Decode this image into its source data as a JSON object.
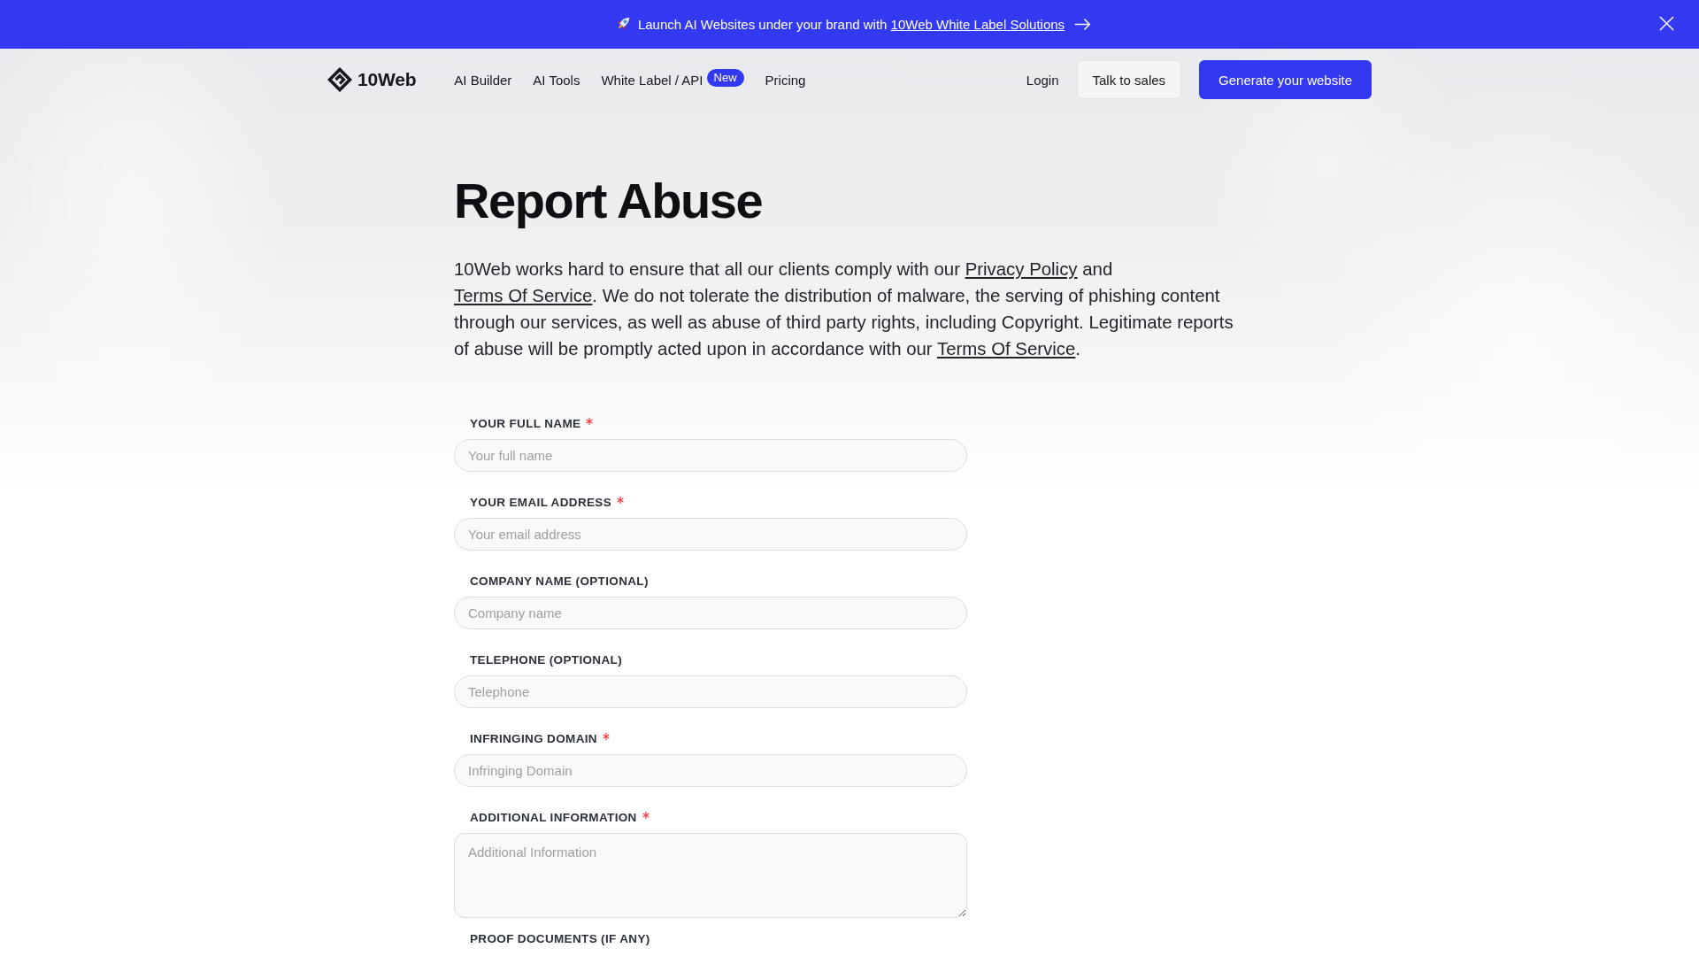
{
  "banner": {
    "message": "Launch AI Websites under your brand with",
    "link": "10Web White Label Solutions"
  },
  "nav": {
    "logo": "10Web",
    "links": [
      {
        "label": "AI Builder"
      },
      {
        "label": "AI Tools"
      },
      {
        "label": "White Label / API",
        "badge": "New"
      },
      {
        "label": "Pricing"
      }
    ],
    "login": "Login",
    "secondary_button": "Talk to sales",
    "primary_button": "Generate your website"
  },
  "page": {
    "title": "Report Abuse",
    "intro": [
      {
        "kind": "text",
        "text": "10Web works hard to ensure that all our clients comply with our "
      },
      {
        "kind": "link",
        "text": "Privacy Policy"
      },
      {
        "kind": "text",
        "text": " and "
      },
      {
        "kind": "link",
        "text": "Terms Of Service"
      },
      {
        "kind": "text",
        "text": ". We do not tolerate the distribution of malware, the serving of phishing content through our services, as well as abuse of third party rights, including Copyright. Legitimate reports of abuse will be promptly acted upon in accordance with our "
      },
      {
        "kind": "link",
        "text": "Terms Of Service"
      },
      {
        "kind": "text",
        "text": "."
      }
    ]
  },
  "form": {
    "fields": [
      {
        "label": "YOUR FULL NAME",
        "required": true,
        "kind": "input",
        "placeholder": "Your full name"
      },
      {
        "label": "YOUR EMAIL ADDRESS",
        "required": true,
        "kind": "input",
        "placeholder": "Your email address"
      },
      {
        "label": "COMPANY NAME (OPTIONAL)",
        "required": false,
        "kind": "input",
        "placeholder": "Company name"
      },
      {
        "label": "TELEPHONE (OPTIONAL)",
        "required": false,
        "kind": "input",
        "placeholder": "Telephone"
      },
      {
        "label": "INFRINGING DOMAIN",
        "required": true,
        "kind": "input",
        "placeholder": "Infringing Domain"
      },
      {
        "label": "ADDITIONAL INFORMATION",
        "required": true,
        "kind": "textarea",
        "placeholder": "Additional Information"
      }
    ],
    "last_label": "PROOF DOCUMENTS (IF ANY)"
  }
}
